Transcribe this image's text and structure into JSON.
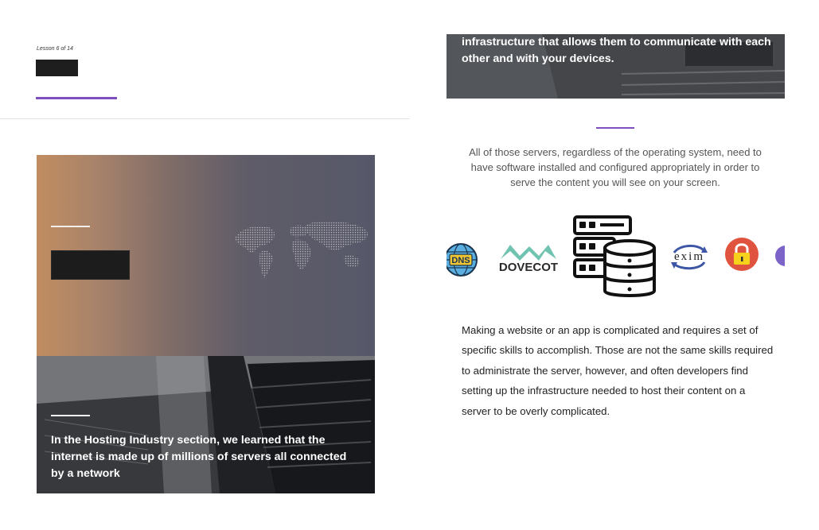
{
  "lesson": {
    "progress_label": "Lesson 6 of 14"
  },
  "hero": {
    "photo_text": "In the Hosting Industry section, we learned that the internet is made up of millions of servers all connected by a network"
  },
  "right": {
    "top_photo_text": "infrastructure that allows them to communicate with each other and with your devices.",
    "center_paragraph": "All of those servers, regardless of the operating system, need to have software installed and configured appropriately in order to serve the content you will see on your screen.",
    "body_paragraph": "Making a website or an app is complicated and requires a set of specific skills to accomplish. Those are not the same skills required to administrate the server, however, and often developers find setting up the infrastructure needed to host their content on a server to be overly complicated."
  },
  "logos": {
    "dns_label": "DNS",
    "dovecot_label": "DOVECOT",
    "exim_label": "exim"
  },
  "colors": {
    "accent_purple": "#7f4fc0",
    "hero_orange": "#c18d60",
    "hero_slate": "#565869",
    "lock_red": "#e0533f",
    "dovecot_teal": "#6fc3b0"
  }
}
